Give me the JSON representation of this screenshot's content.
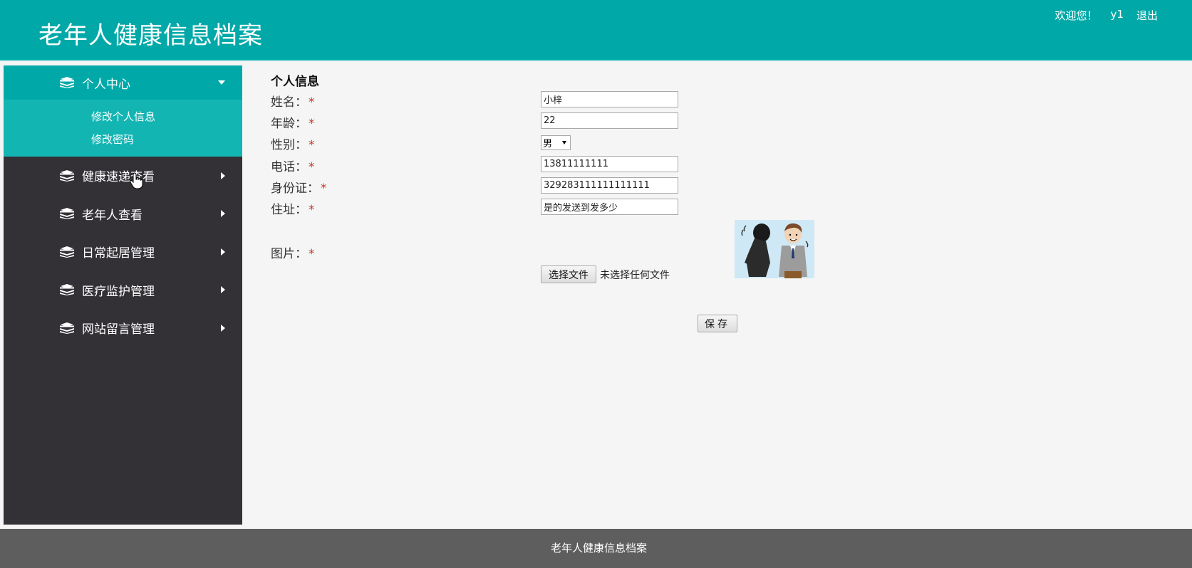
{
  "header": {
    "title": "老年人健康信息档案",
    "welcome": "欢迎您！",
    "username": "y1",
    "logout": "退出"
  },
  "sidebar": {
    "groups": [
      {
        "label": "个人中心",
        "expanded": true,
        "items": [
          {
            "label": "修改个人信息"
          },
          {
            "label": "修改密码"
          }
        ]
      },
      {
        "label": "健康速递查看",
        "expanded": false
      },
      {
        "label": "老年人查看",
        "expanded": false
      },
      {
        "label": "日常起居管理",
        "expanded": false
      },
      {
        "label": "医疗监护管理",
        "expanded": false
      },
      {
        "label": "网站留言管理",
        "expanded": false
      }
    ]
  },
  "form": {
    "section_title": "个人信息",
    "required_mark": "*",
    "fields": {
      "name": {
        "label": "姓名：",
        "value": "小梓"
      },
      "age": {
        "label": "年龄：",
        "value": "22"
      },
      "gender": {
        "label": "性别：",
        "value": "男"
      },
      "phone": {
        "label": "电话：",
        "value": "13811111111"
      },
      "id_card": {
        "label": "身份证：",
        "value": "329283111111111111"
      },
      "address": {
        "label": "住址：",
        "value": "是的发送到发多少"
      },
      "picture": {
        "label": "图片："
      }
    },
    "file_button": "选择文件",
    "file_status": "未选择任何文件",
    "save_button": "保存"
  },
  "footer": {
    "text": "老年人健康信息档案"
  },
  "colors": {
    "header_bg": "#00a9a8",
    "sidebar_bg": "#333136",
    "submenu_bg": "#13b5b3",
    "footer_bg": "#5e5e5e"
  }
}
